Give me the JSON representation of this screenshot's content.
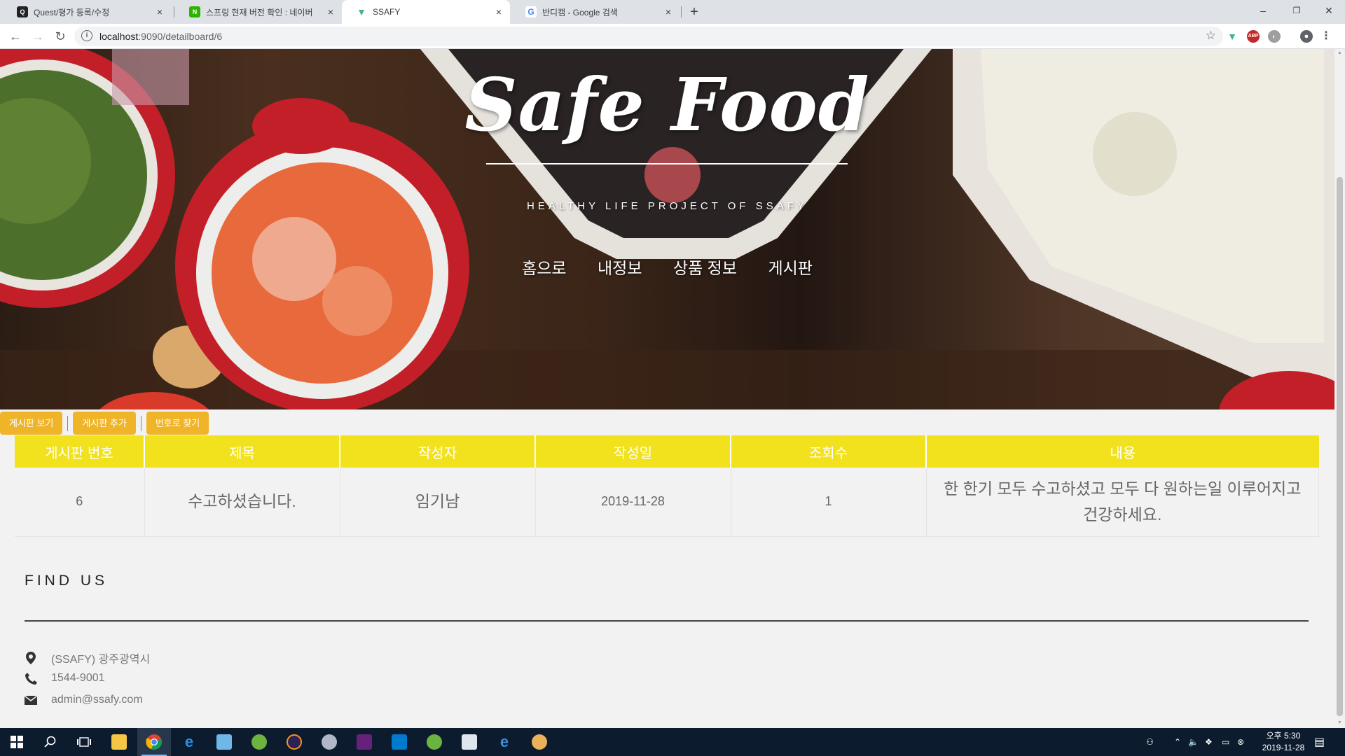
{
  "browser": {
    "tabs": [
      {
        "title": "Quest/평가 등록/수정",
        "active": false
      },
      {
        "title": "스프링 현재 버전 확인 : 네이버",
        "active": false
      },
      {
        "title": "SSAFY",
        "active": true
      },
      {
        "title": "반디캠 - Google 검색",
        "active": false
      }
    ],
    "close_glyph": "×",
    "new_tab_glyph": "+",
    "url_host": "localhost",
    "url_path": ":9090/detailboard/6",
    "window_controls": [
      "–",
      "❐",
      "✕"
    ]
  },
  "site": {
    "brand": "Safe Food",
    "tagline": "HEALTHY LIFE PROJECT OF SSAFY",
    "nav": [
      "홈으로",
      "내정보",
      "상품 정보",
      "게시판"
    ]
  },
  "board": {
    "actions": [
      "게시판 보기",
      "게시판 추가",
      "번호로 찾기"
    ],
    "columns": [
      "게시판 번호",
      "제목",
      "작성자",
      "작성일",
      "조회수",
      "내용"
    ],
    "rows": [
      {
        "no": "6",
        "title": "수고하셨습니다.",
        "author": "임기남",
        "date": "2019-11-28",
        "views": "1",
        "content": "한 한기 모두 수고하셨고 모두 다 원하는일 이루어지고 건강하세요."
      }
    ]
  },
  "footer": {
    "heading": "FIND US",
    "address": "(SSAFY) 광주광역시",
    "phone": "1544-9001",
    "email": "admin@ssafy.com"
  },
  "taskbar": {
    "clock_time": "오후 5:30",
    "clock_date": "2019-11-28"
  },
  "colors": {
    "accent_yellow": "#f2e21e",
    "button_orange": "#f0b429",
    "taskbar": "#0c1b2e"
  }
}
